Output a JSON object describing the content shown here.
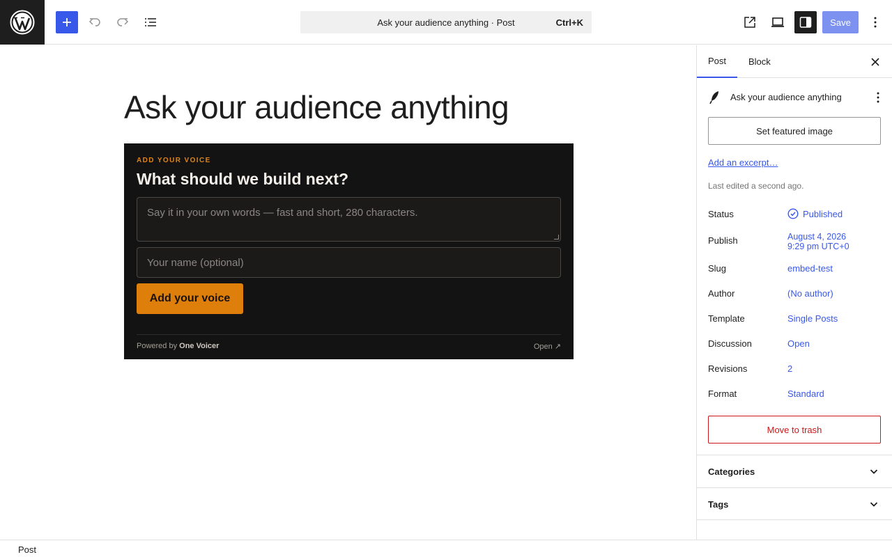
{
  "header": {
    "command_text": "Ask your audience anything · Post",
    "shortcut": "Ctrl+K",
    "save_label": "Save"
  },
  "icons": {
    "logo": "wordpress-icon",
    "add": "plus-icon",
    "undo": "undo-icon",
    "redo": "redo-icon",
    "list_view": "list-view-icon",
    "view": "external-link-icon",
    "device": "desktop-icon",
    "settings": "sidebar-settings-icon",
    "options": "more-vertical-icon"
  },
  "editor": {
    "post_title": "Ask your audience anything"
  },
  "embed": {
    "eyebrow": "ADD YOUR VOICE",
    "question": "What should we build next?",
    "textarea_placeholder": "Say it in your own words — fast and short, 280 characters.",
    "name_placeholder": "Your name (optional)",
    "button_label": "Add your voice",
    "powered_prefix": "Powered by",
    "powered_brand": "One Voicer",
    "open_label": "Open ↗"
  },
  "sidebar": {
    "tabs": [
      "Post",
      "Block"
    ],
    "post_title": "Ask your audience anything",
    "featured_image_label": "Set featured image",
    "excerpt_link": "Add an excerpt…",
    "last_edited": "Last edited a second ago.",
    "rows": {
      "status": {
        "label": "Status",
        "value": "Published"
      },
      "publish": {
        "label": "Publish",
        "value_line1": "August 4, 2026",
        "value_line2": "9:29 pm UTC+0"
      },
      "slug": {
        "label": "Slug",
        "value": "embed-test"
      },
      "author": {
        "label": "Author",
        "value": "(No author)"
      },
      "template": {
        "label": "Template",
        "value": "Single Posts"
      },
      "discussion": {
        "label": "Discussion",
        "value": "Open"
      },
      "revisions": {
        "label": "Revisions",
        "value": "2"
      },
      "format": {
        "label": "Format",
        "value": "Standard"
      }
    },
    "trash_label": "Move to trash",
    "panels": [
      "Categories",
      "Tags"
    ]
  },
  "footer": {
    "breadcrumb": "Post"
  },
  "colors": {
    "accent": "#3858e9",
    "embed_bg": "#141313",
    "embed_accent": "#de7f0b",
    "danger": "#cc1818"
  }
}
